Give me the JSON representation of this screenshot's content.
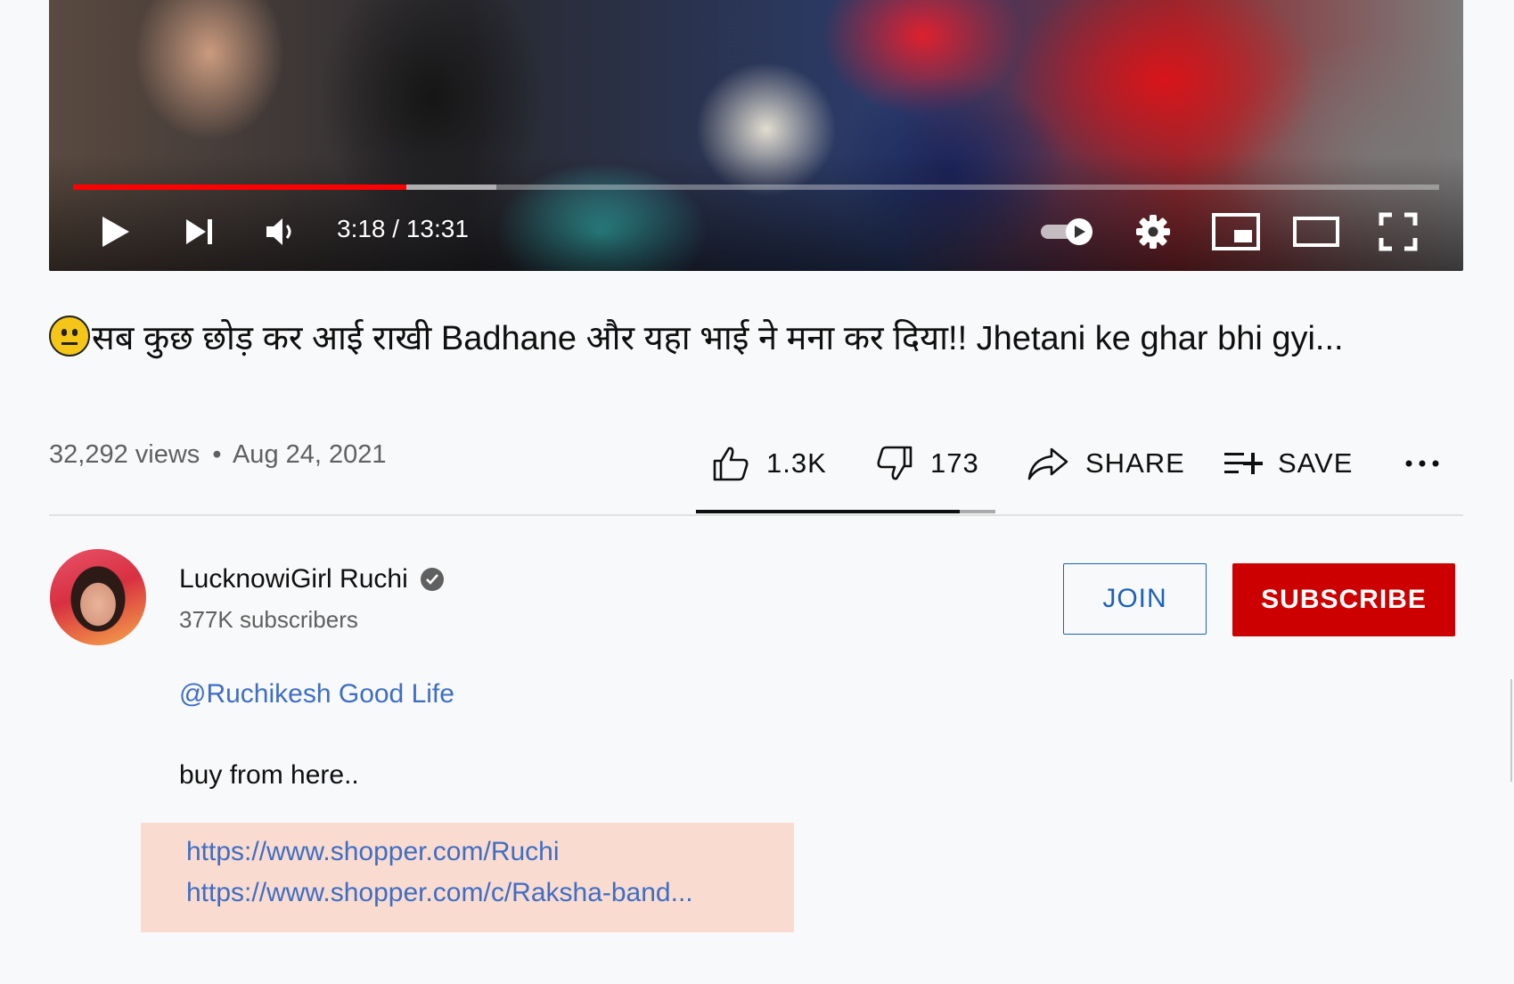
{
  "player": {
    "time_display": "3:18 / 13:31",
    "progress_fraction": 0.244,
    "buffered_fraction": 0.31,
    "progress_color": "#ff0000"
  },
  "video": {
    "emoji": "😐",
    "title": "सब कुछ छोड़ कर आई राखी Badhane और यहा भाई ने मना कर दिया!! Jhetani ke ghar bhi gyi...",
    "views": "32,292 views",
    "separator": "•",
    "date": "Aug 24, 2021"
  },
  "actions": {
    "like_count": "1.3K",
    "dislike_count": "173",
    "share_label": "SHARE",
    "save_label": "SAVE",
    "more_label": "..."
  },
  "channel": {
    "name": "LucknowiGirl Ruchi",
    "subscribers": "377K subscribers",
    "join_label": "JOIN",
    "subscribe_label": "SUBSCRIBE"
  },
  "description": {
    "mention": "@Ruchikesh Good Life",
    "text": "buy from here..",
    "links": [
      "https://www.shopper.com/Ruchi",
      "https://www.shopper.com/c/Raksha-band..."
    ]
  },
  "colors": {
    "subscribe": "#cc0000",
    "link": "#3e6ec4",
    "join": "#1c62b9",
    "highlight": "#fadbd0"
  }
}
